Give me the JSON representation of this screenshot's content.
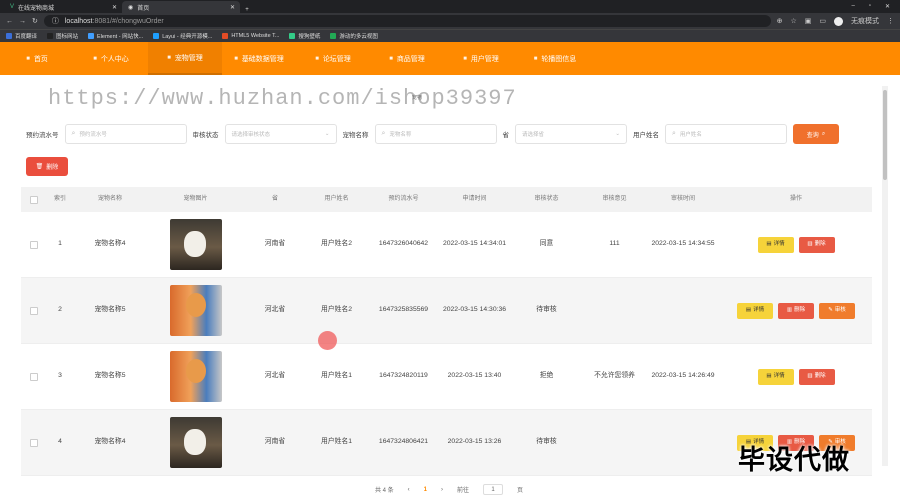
{
  "browser": {
    "tabs": [
      {
        "label": "在线宠物商城",
        "icon": "vue-icon"
      },
      {
        "label": "首页",
        "icon": "globe-icon"
      }
    ],
    "url_host": "localhost",
    "url_path": ":8081/#/chongwuOrder",
    "profile_label": "无痕模式",
    "bookmarks": [
      "百度翻译",
      "图标网站",
      "Element - 网站快...",
      "Layui - 经典开源模...",
      "HTML5 Website T...",
      "搜狗壁纸",
      "游动的多云视图"
    ]
  },
  "nav": {
    "items": [
      "首页",
      "个人中心",
      "宠物管理",
      "基础数据管理",
      "论坛管理",
      "商品管理",
      "用户管理",
      "轮播图信息"
    ],
    "active_index": 2
  },
  "watermark": "https://www.huzhan.com/ishop39397",
  "page_subtitle": "宠物",
  "filters": {
    "order_no_label": "预约流水号",
    "order_no_placeholder": "预约流水号",
    "status_label": "审核状态",
    "status_placeholder": "请选择审核状态",
    "pet_label": "宠物名称",
    "pet_placeholder": "宠物名称",
    "province_label": "省",
    "province_placeholder": "请选择省",
    "user_label": "用户姓名",
    "user_placeholder": "用户姓名",
    "query_label": "查询"
  },
  "delete_button": "删除",
  "table": {
    "headers": [
      "索引",
      "宠物名称",
      "宠物图片",
      "省",
      "用户姓名",
      "预约流水号",
      "申请时间",
      "审核状态",
      "审核意见",
      "审核时间",
      "操作"
    ],
    "rows": [
      {
        "index": "1",
        "pet": "宠物名称4",
        "province": "河南省",
        "user": "用户姓名2",
        "order_no": "1647326040642",
        "apply_time": "2022-03-15 14:34:01",
        "status": "同意",
        "opinion": "111",
        "audit_time": "2022-03-15 14:34:55",
        "actions": [
          "详情",
          "删除"
        ]
      },
      {
        "index": "2",
        "pet": "宠物名称5",
        "province": "河北省",
        "user": "用户姓名2",
        "order_no": "1647325835569",
        "apply_time": "2022-03-15 14:30:36",
        "status": "待审核",
        "opinion": "",
        "audit_time": "",
        "actions": [
          "详情",
          "删除",
          "审核"
        ]
      },
      {
        "index": "3",
        "pet": "宠物名称5",
        "province": "河北省",
        "user": "用户姓名1",
        "order_no": "1647324820119",
        "apply_time": "2022-03-15 13:40",
        "status": "拒绝",
        "opinion": "不允许您领养",
        "audit_time": "2022-03-15 14:26:49",
        "actions": [
          "详情",
          "删除"
        ]
      },
      {
        "index": "4",
        "pet": "宠物名称4",
        "province": "河南省",
        "user": "用户姓名1",
        "order_no": "1647324806421",
        "apply_time": "2022-03-15 13:26",
        "status": "待审核",
        "opinion": "",
        "audit_time": "",
        "actions": [
          "详情",
          "删除",
          "审核"
        ]
      }
    ]
  },
  "pagination": {
    "total": "共 4 条",
    "current": "1",
    "goto_label": "前往",
    "goto_value": "1",
    "page_unit": "页"
  },
  "corner_text": "毕设代做",
  "colors": {
    "nav": "#ff8a00",
    "query": "#f0702c",
    "delete": "#e85a44",
    "detail": "#f6d33a",
    "audit": "#f07c2c"
  }
}
